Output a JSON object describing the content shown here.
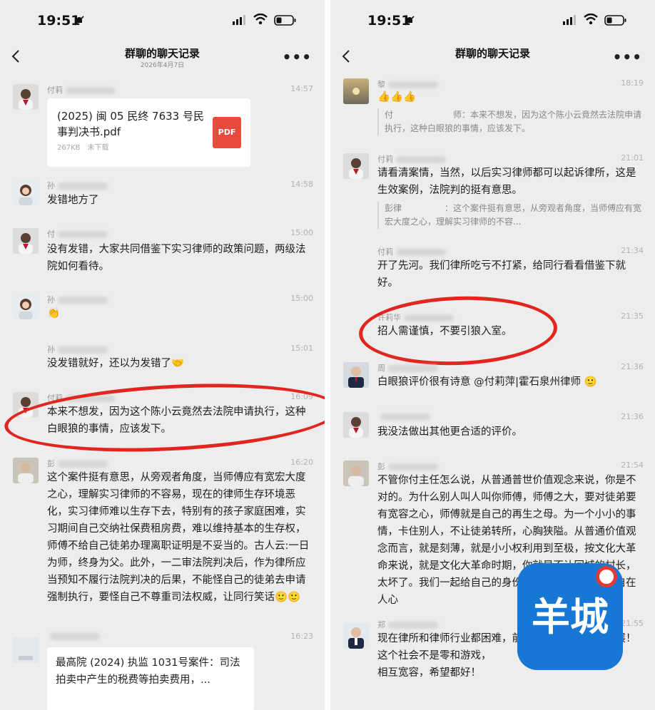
{
  "left": {
    "status_time": "19:51",
    "title": "群聊的聊天记录",
    "subtitle": "2026年4月7日",
    "messages": [
      {
        "name": "付莉",
        "time": "14:57",
        "file_name": "(2025) 闽 05 民终 7633 号民事判决书.pdf",
        "file_size": "267KB",
        "file_status": "未下载",
        "file_badge": "PDF"
      },
      {
        "name": "孙",
        "time": "14:58",
        "text": "发错地方了"
      },
      {
        "name": "付",
        "time": "15:00",
        "text": "没有发错，大家共同借鉴下实习律师的政策问题，两级法院如何看待。"
      },
      {
        "name": "孙",
        "time": "15:00",
        "text": "👏"
      },
      {
        "name": "孙",
        "time": "15:01",
        "text": "没发错就好，还以为发错了🤝"
      },
      {
        "name": "付莉",
        "time": "16:09",
        "text": "本来不想发，因为这个陈小云竟然去法院申请执行，这种白眼狼的事情，应该发下。"
      },
      {
        "name": "彭",
        "time": "16:20",
        "text": "这个案件挺有意思，从旁观者角度，当师傅应有宽宏大度之心，理解实习律师的不容易，现在的律师生存环境恶化，实习律师难以生存下去，特别有的孩子家庭困难，实习期间自己交纳社保费租房费，难以维持基本的生存权，师傅不给自己徒弟办理离职证明是不妥当的。古人云:一日为师，终身为父。此外，一二审法院判决后，作为律所应当预知不履行法院判决的后果，不能怪自己的徒弟去申请强制执行，要怪自己不尊重司法权威，让同行笑话🙂🙂"
      },
      {
        "name": "",
        "time": "16:23",
        "text": "最高院 (2024) 执监 1031号案件：司法拍卖中产生的税费等拍卖费用，..."
      }
    ]
  },
  "right": {
    "status_time": "19:51",
    "title": "群聊的聊天记录",
    "messages": [
      {
        "name": "黎",
        "time": "18:19",
        "text": "👍👍👍",
        "quote": "付　　　　　　　师：本来不想发，因为这个陈小云竟然去法院申请执行，这种白眼狼的事情，应该发下。"
      },
      {
        "name": "付莉",
        "time": "21:01",
        "text": "请看清案情，当然，以后实习律师都可以起诉律所，这是生效案例，法院判的挺有意思。",
        "quote": "彭律　　　　　：这个案件挺有意思，从旁观者角度，当师傅应有宽宏大度之心，理解实习律师的不容..."
      },
      {
        "name": "付莉",
        "time": "21:34",
        "text": "开了先河。我们律所吃亏不打紧，给同行看看借鉴下就好。"
      },
      {
        "name": "许莉华",
        "time": "21:35",
        "text": "招人需谨慎，不要引狼入室。"
      },
      {
        "name": "周",
        "time": "21:36",
        "text": "白眼狼评价很有诗意 @付莉萍|霍石泉州律师 🙂"
      },
      {
        "name": "",
        "time": "21:36",
        "text": "我没法做出其他更合适的评价。"
      },
      {
        "name": "彭",
        "time": "21:54",
        "text": "不管你付主任怎么说，从普通普世价值观念来说，你是不对的。为什么别人叫人叫你师傅，师傅之大，要对徒弟要有宽容之心，师傅就是自己的再生之母。为一个小小的事情，卡住别人，不让徒弟转所，心胸狭隘。从普通价值观念而言，就是刻薄，就是小小权利用到至极，按文化大革命来说，就是文化大革命时期，你就是不让回城的村长，太坏了。我们一起给自己的身份发表看法而已。公道自在人心"
      },
      {
        "name": "郑",
        "time": "21:55",
        "text": "现在律所和律师行业都困难，前辈和后辈都要健康发展！\n这个社会不是零和游戏，\n相互宽容，希望都好！"
      }
    ],
    "watermark": "羊城"
  },
  "colors": {
    "ring": "#e0261e",
    "pdf": "#e84a3e",
    "watermark": "#1677d4"
  }
}
